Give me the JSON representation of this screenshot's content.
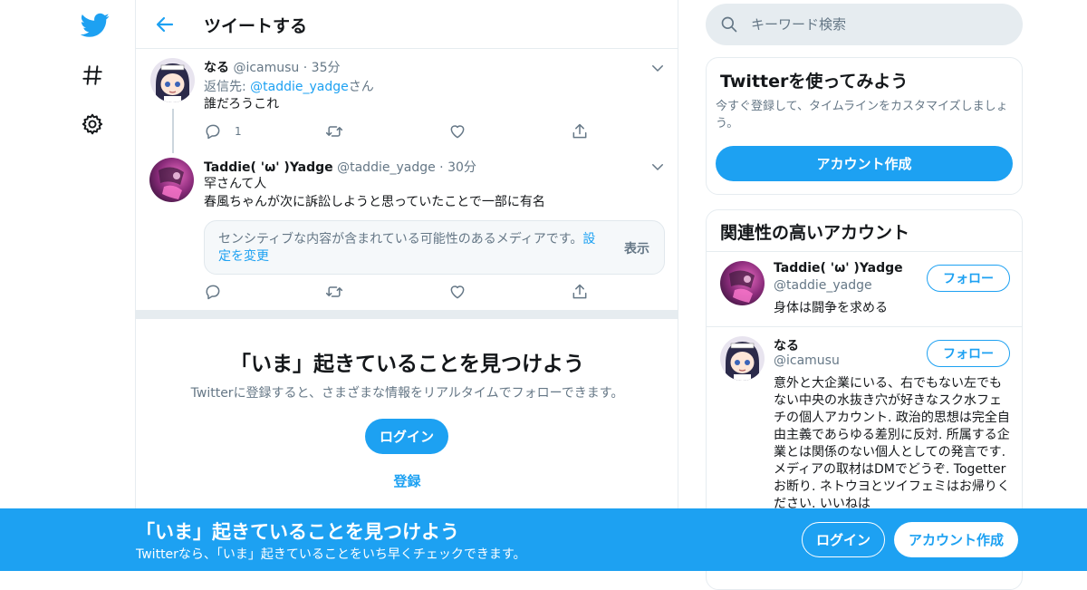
{
  "colors": {
    "accent": "#1da1f2",
    "text": "#14171a",
    "secondary": "#657786",
    "border": "#e6ecf0"
  },
  "nav": {
    "icons": [
      "twitter-logo-icon",
      "hashtag-icon",
      "gear-icon"
    ]
  },
  "header": {
    "title": "ツイートする"
  },
  "tweets": [
    {
      "name": "なる",
      "handle": "@icamusu",
      "dot": "·",
      "time": "35分",
      "reply_prefix": "返信先: ",
      "reply_to": "@taddie_yadge",
      "reply_suffix": "さん",
      "text": "誰だろうこれ",
      "reply_count": "1"
    },
    {
      "name": "Taddie( 'ω' )Yadge",
      "handle": "@taddie_yadge",
      "dot": "·",
      "time": "30分",
      "text_line1": "罕さんて人",
      "text_line2": "春風ちゃんが次に訴訟しようと思っていたことで一部に有名",
      "sensitive_msg": "センシティブな内容が含まれている可能性のあるメディアです。",
      "sensitive_link": "設定を変更",
      "sensitive_show": "表示",
      "reply_count": ""
    }
  ],
  "discover": {
    "title": "「いま」起きていることを見つけよう",
    "subtitle": "Twitterに登録すると、さまざまな情報をリアルタイムでフォローできます。",
    "login": "ログイン",
    "signup": "登録"
  },
  "search": {
    "placeholder": "キーワード検索"
  },
  "try_twitter": {
    "title": "Twitterを使ってみよう",
    "subtitle": "今すぐ登録して、タイムラインをカスタマイズしましょう。",
    "button": "アカウント作成"
  },
  "related": {
    "title": "関連性の高いアカウント",
    "follow_label": "フォロー",
    "accounts": [
      {
        "name": "Taddie( 'ω' )Yadge",
        "handle": "@taddie_yadge",
        "bio": "身体は闘争を求める"
      },
      {
        "name": "なる",
        "handle": "@icamusu",
        "bio": "意外と大企業にいる、右でもない左でもない中央の水抜き穴が好きなスク水フェチの個人アカウント. 政治的思想は完全自由主義であらゆる差別に反対. 所属する企業とは関係のない個人としての発言です. メディアの取材はDMでどうぞ. Togetterお断り. ネトウヨとツイフェミはお帰りください. いいねは"
      }
    ]
  },
  "bottombar": {
    "title": "「いま」起きていることを見つけよう",
    "subtitle": "Twitterなら、「いま」起きていることをいち早くチェックできます。",
    "login": "ログイン",
    "signup": "アカウント作成"
  }
}
